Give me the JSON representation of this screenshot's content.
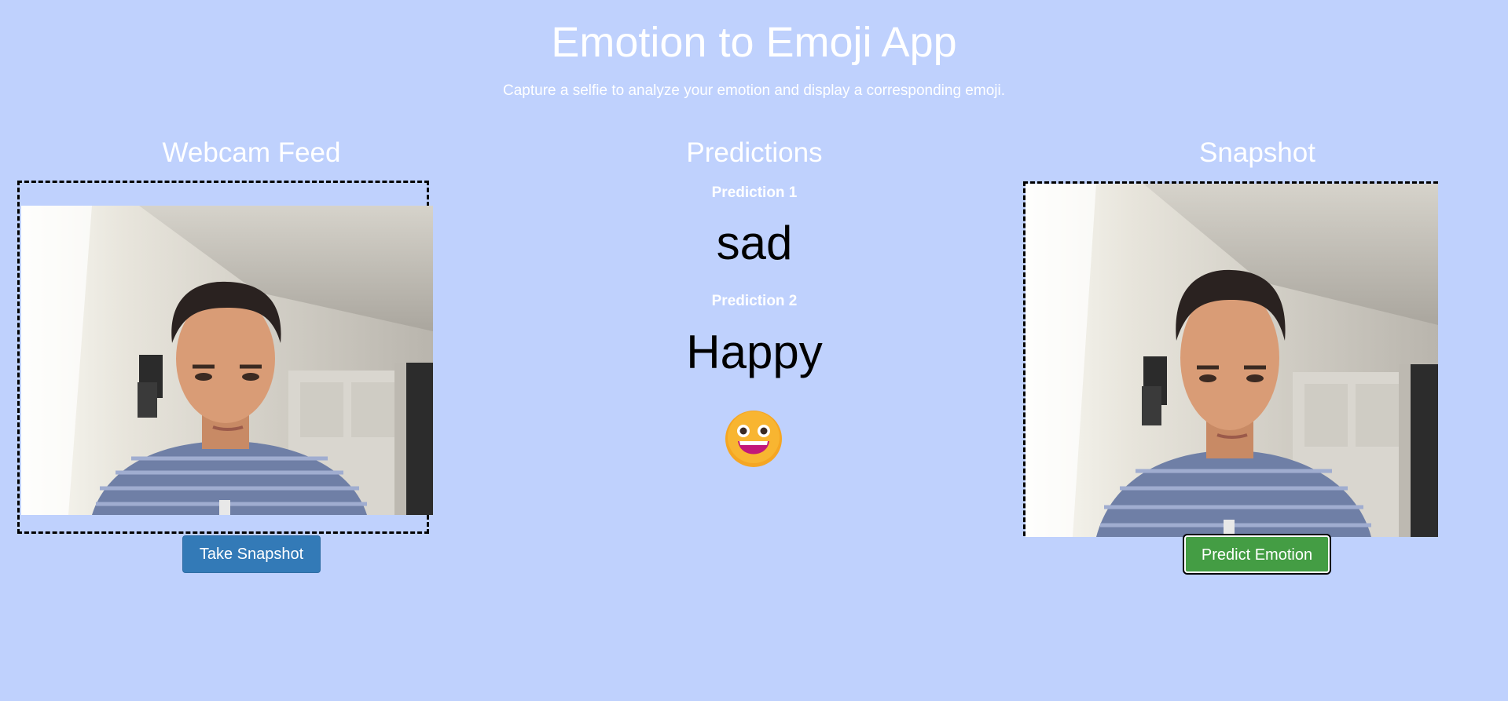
{
  "header": {
    "title": "Emotion to Emoji App",
    "subtitle": "Capture a selfie to analyze your emotion and display a corresponding emoji."
  },
  "webcam": {
    "heading": "Webcam Feed",
    "button_label": "Take Snapshot"
  },
  "predictions": {
    "heading": "Predictions",
    "items": [
      {
        "label": "Prediction 1",
        "value": "sad"
      },
      {
        "label": "Prediction 2",
        "value": "Happy"
      }
    ],
    "emoji_icon": "grinning-face-icon"
  },
  "snapshot": {
    "heading": "Snapshot",
    "button_label": "Predict Emotion"
  },
  "colors": {
    "background": "#bfd1fd",
    "primary_button": "#337ab7",
    "success_button": "#449d44",
    "emoji_face": "#f5a623",
    "emoji_mouth": "#c2187a"
  }
}
